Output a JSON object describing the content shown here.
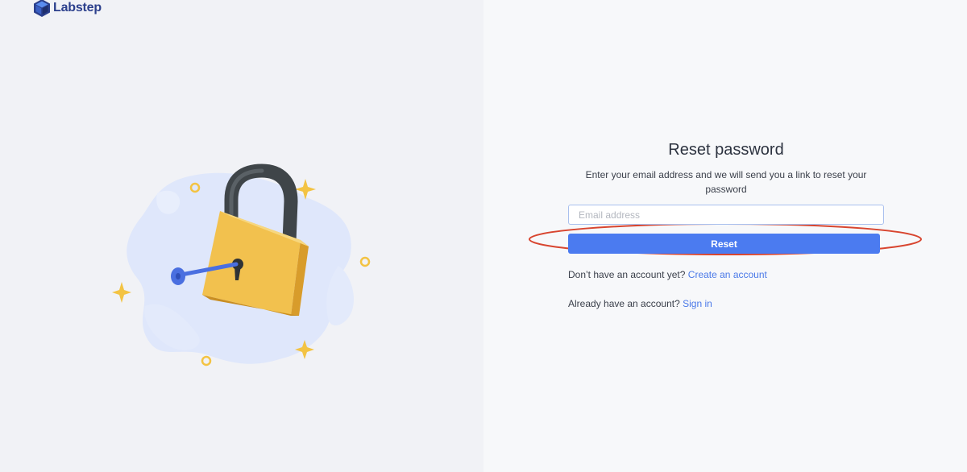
{
  "brand": {
    "name": "Labstep",
    "logo_icon": "labstep-cube-icon"
  },
  "illustration": {
    "icon": "padlock-with-key-icon"
  },
  "form": {
    "title": "Reset password",
    "subtitle": "Enter your email address and we will send you a link to reset your password",
    "email_placeholder": "Email address",
    "email_value": "",
    "reset_label": "Reset"
  },
  "signup": {
    "prompt": "Don’t have an account yet?",
    "link_label": "Create an account"
  },
  "signin": {
    "prompt": "Already have an account?",
    "link_label": "Sign in"
  },
  "colors": {
    "primary": "#4b7bf0",
    "link": "#4a79e8",
    "highlight": "#d8452f",
    "lock_body": "#f2c14e",
    "key": "#4a6fe0"
  }
}
